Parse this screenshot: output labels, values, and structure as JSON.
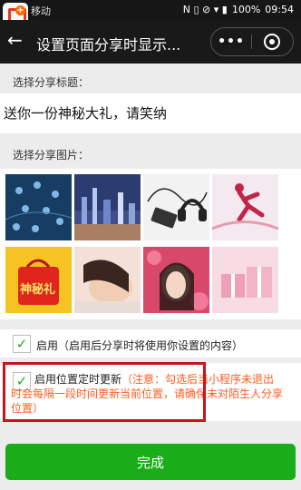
{
  "statusbar": {
    "carrier": "移动",
    "indicators": "N ▯ ⊘ ▾ ▮",
    "battery": "100%",
    "time": "09:54"
  },
  "navbar": {
    "back_icon": "←",
    "title": "设置页面分享时显示...",
    "more_icon": "•••"
  },
  "form": {
    "title_label": "选择分享标题：",
    "title_value": "送你一份神秘大礼，请笑纳",
    "image_label": "选择分享图片：",
    "images": [
      {
        "name": "map-pins"
      },
      {
        "name": "city-night"
      },
      {
        "name": "headphones-phone"
      },
      {
        "name": "runner-abstract"
      },
      {
        "name": "gift-bag-shenmili",
        "text": "神秘礼"
      },
      {
        "name": "girl-lying"
      },
      {
        "name": "girl-flowers"
      },
      {
        "name": "pink-gift-boxes"
      }
    ]
  },
  "enable": {
    "checked_icon": "✓",
    "label": "启用（启用后分享时将使用你设置的内容）"
  },
  "location": {
    "checked_icon": "✓",
    "label": "启用位置定时更新",
    "note": "（注意：勾选后当小程序未退出时会每隔一段时间更新当前位置，请确保未对陌生人分享位置）"
  },
  "footer": {
    "done_label": "完成"
  },
  "colors": {
    "accent": "#1aad19",
    "warning": "#ff5a1f",
    "highlight": "#c8141b"
  }
}
